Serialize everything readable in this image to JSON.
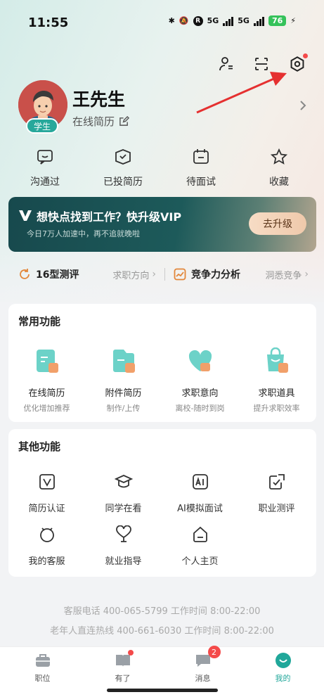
{
  "status_bar": {
    "time": "11:55",
    "network_1": "5G",
    "network_2": "5G",
    "battery": "76"
  },
  "header": {
    "icons": [
      "contacts-switch-icon",
      "scan-icon",
      "settings-icon"
    ]
  },
  "profile": {
    "name": "王先生",
    "role_badge": "学生",
    "resume_link": "在线简历"
  },
  "stats": [
    {
      "label": "沟通过",
      "icon": "chat-icon"
    },
    {
      "label": "已投简历",
      "icon": "sent-resume-icon"
    },
    {
      "label": "待面试",
      "icon": "calendar-icon"
    },
    {
      "label": "收藏",
      "icon": "star-icon"
    }
  ],
  "vip": {
    "title": "想快点找到工作？快升级VIP",
    "subtitle": "今日7万人加速中，再不追就晚啦",
    "button": "去升级"
  },
  "assessment": {
    "left_title": "16型测评",
    "left_hint": "求职方向",
    "right_title": "竞争力分析",
    "right_hint": "洞悉竞争"
  },
  "common_functions": {
    "title": "常用功能",
    "items": [
      {
        "name": "在线简历",
        "desc": "优化增加推荐"
      },
      {
        "name": "附件简历",
        "desc": "制作/上传"
      },
      {
        "name": "求职意向",
        "desc": "离校-随时到岗"
      },
      {
        "name": "求职道具",
        "desc": "提升求职效率"
      }
    ]
  },
  "other_functions": {
    "title": "其他功能",
    "items": [
      {
        "name": "简历认证"
      },
      {
        "name": "同学在看"
      },
      {
        "name": "AI模拟面试"
      },
      {
        "name": "职业测评"
      },
      {
        "name": "我的客服"
      },
      {
        "name": "就业指导"
      },
      {
        "name": "个人主页"
      }
    ]
  },
  "footer": {
    "line1": "客服电话 400-065-5799  工作时间 8:00-22:00",
    "line2": "老年人直连热线 400-661-6030 工作时间 8:00-22:00"
  },
  "tabbar": {
    "tabs": [
      {
        "label": "职位"
      },
      {
        "label": "有了"
      },
      {
        "label": "消息",
        "badge": "2"
      },
      {
        "label": "我的"
      }
    ]
  },
  "colors": {
    "accent": "#20a79a",
    "vip_bg": "#17494d",
    "badge": "#f44a4a"
  }
}
